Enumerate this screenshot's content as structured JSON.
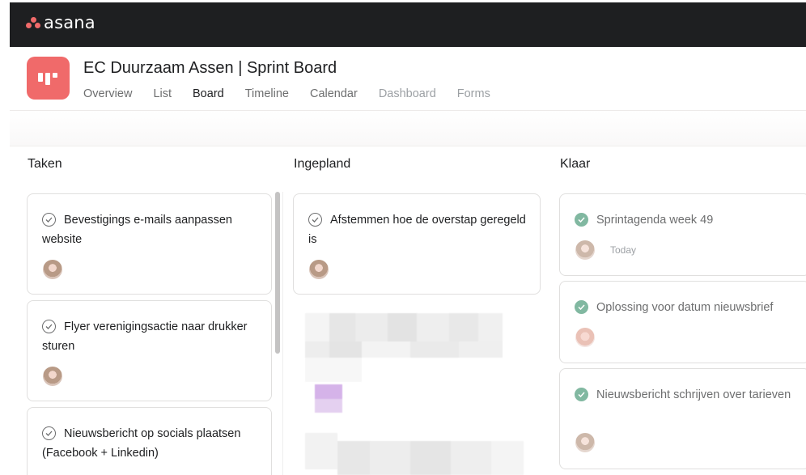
{
  "app": {
    "logo_text": "asana",
    "brand_color": "#f06a6a",
    "topbar_color": "#1e1f21"
  },
  "project": {
    "title": "EC Duurzaam Assen | Sprint Board",
    "tabs": [
      {
        "label": "Overview",
        "state": "inactive"
      },
      {
        "label": "List",
        "state": "inactive"
      },
      {
        "label": "Board",
        "state": "active"
      },
      {
        "label": "Timeline",
        "state": "inactive"
      },
      {
        "label": "Calendar",
        "state": "inactive"
      },
      {
        "label": "Dashboard",
        "state": "disabled"
      },
      {
        "label": "Forms",
        "state": "disabled"
      }
    ]
  },
  "board": {
    "columns": [
      {
        "title": "Taken",
        "cards": [
          {
            "title": "Bevestigings e-mails aanpassen website",
            "completed": false,
            "avatar": "avatar-icon"
          },
          {
            "title": "Flyer verenigingsactie naar drukker sturen",
            "completed": false,
            "avatar": "avatar-icon"
          },
          {
            "title": "Nieuwsbericht op socials plaatsen (Facebook + Linkedin)",
            "completed": false
          }
        ]
      },
      {
        "title": "Ingepland",
        "cards": [
          {
            "title": "Afstemmen hoe de overstap geregeld is",
            "completed": false,
            "avatar": "avatar-icon"
          }
        ]
      },
      {
        "title": "Klaar",
        "cards": [
          {
            "title": "Sprintagenda week 49",
            "completed": true,
            "avatar": "avatar-icon",
            "due": "Today"
          },
          {
            "title": "Oplossing voor datum nieuwsbrief",
            "completed": true,
            "avatar": "avatar-icon"
          },
          {
            "title": "Nieuwsbericht schrijven over tarieven",
            "completed": true,
            "avatar": "avatar-icon"
          }
        ]
      }
    ],
    "complete_color": "#58a182"
  }
}
